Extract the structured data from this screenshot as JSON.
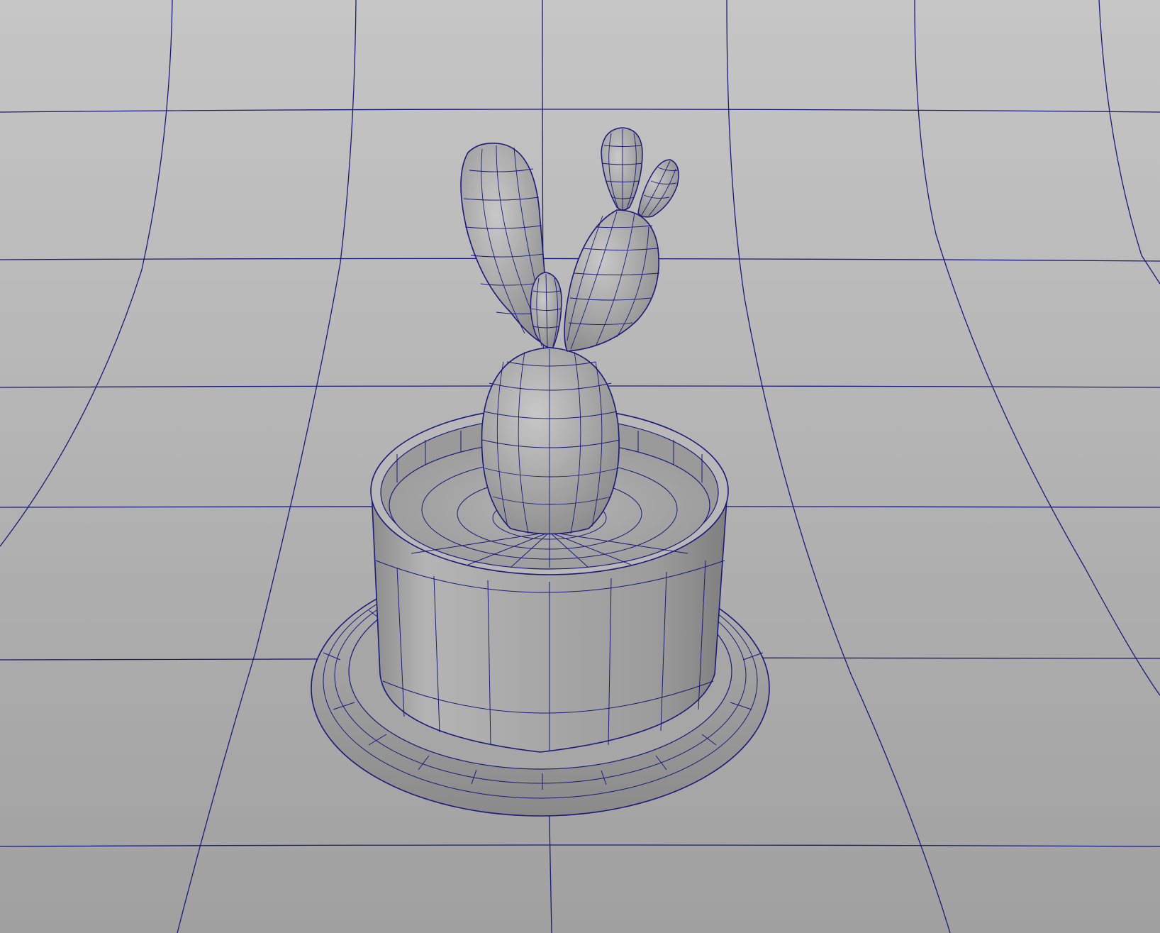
{
  "scene": {
    "shading_mode": "wireframe-on-shaded",
    "objects": [
      "ground-cyclorama",
      "saucer",
      "pot",
      "soil",
      "cactus-body",
      "cactus-pad-left",
      "cactus-pad-small",
      "cactus-pad-right",
      "cactus-bud-top",
      "cactus-bud-side"
    ]
  },
  "colors": {
    "background_top": "#c4c4c4",
    "background_bottom": "#a2a2a2",
    "wire": "#1a1a7a",
    "surface_light": "#c6c6c6",
    "surface_mid": "#acacac",
    "surface_dark": "#8e8e8e"
  }
}
